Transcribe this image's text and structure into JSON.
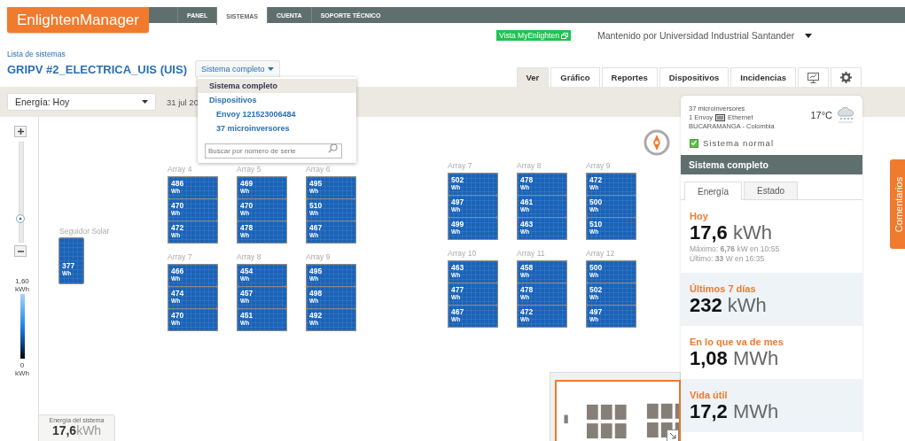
{
  "header": {
    "logo": "EnlightenManager",
    "nav": [
      {
        "label": "PANEL",
        "selected": false
      },
      {
        "label": "SISTEMAS",
        "selected": true
      },
      {
        "label": "CUENTA",
        "selected": false
      },
      {
        "label": "SOPORTE TÉCNICO",
        "selected": false
      }
    ]
  },
  "myenlighten_link": "Vista MyEnlighten",
  "maintainer": "Mantenido por Universidad Industrial Santander",
  "breadcrumb": "Lista de sistemas",
  "system_title": "GRIPV #2_ELECTRICA_UIS (UIS)",
  "scope_dropdown": {
    "value": "Sistema completo",
    "expanded": true,
    "items": [
      {
        "label": "Sistema completo",
        "kind": "option",
        "selected": true
      },
      {
        "label": "Dispositivos",
        "kind": "heading",
        "selected": false
      },
      {
        "label": "Envoy 121523006484",
        "kind": "device",
        "selected": false
      },
      {
        "label": "37 microinversores",
        "kind": "device",
        "selected": false
      }
    ],
    "search_placeholder": "Buscar por número de serie"
  },
  "view_tabs": [
    {
      "kind": "text",
      "label": "Ver",
      "selected": true
    },
    {
      "kind": "text",
      "label": "Gráfico",
      "selected": false
    },
    {
      "kind": "text",
      "label": "Reportes",
      "selected": false
    },
    {
      "kind": "text",
      "label": "Dispositivos",
      "selected": false
    },
    {
      "kind": "text",
      "label": "Incidencias",
      "selected": false
    },
    {
      "kind": "display",
      "selected": false
    },
    {
      "kind": "settings",
      "selected": false
    }
  ],
  "energy_select": "Energía: Hoy",
  "date": "31 jul 20",
  "zoom": {
    "level": 0.24
  },
  "legend": {
    "max": "1,60",
    "max_unit": "kWh",
    "min": "0",
    "min_unit": "kWh"
  },
  "tracker": {
    "label": "Seguidor Solar",
    "value": "377",
    "unit": "Wh"
  },
  "array_groups": [
    {
      "arrays": [
        {
          "label": "Array 4",
          "panels": [
            {
              "value": "486",
              "unit": "Wh"
            },
            {
              "value": "470",
              "unit": "Wh"
            },
            {
              "value": "472",
              "unit": "Wh"
            }
          ]
        },
        {
          "label": "Array 5",
          "panels": [
            {
              "value": "469",
              "unit": "Wh"
            },
            {
              "value": "470",
              "unit": "Wh"
            },
            {
              "value": "478",
              "unit": "Wh"
            }
          ]
        },
        {
          "label": "Array 6",
          "panels": [
            {
              "value": "495",
              "unit": "Wh"
            },
            {
              "value": "510",
              "unit": "Wh"
            },
            {
              "value": "467",
              "unit": "Wh"
            }
          ]
        },
        {
          "label": "Array 7",
          "panels": [
            {
              "value": "466",
              "unit": "Wh"
            },
            {
              "value": "474",
              "unit": "Wh"
            },
            {
              "value": "470",
              "unit": "Wh"
            }
          ]
        },
        {
          "label": "Array 8",
          "panels": [
            {
              "value": "454",
              "unit": "Wh"
            },
            {
              "value": "457",
              "unit": "Wh"
            },
            {
              "value": "451",
              "unit": "Wh"
            }
          ]
        },
        {
          "label": "Array 9",
          "panels": [
            {
              "value": "495",
              "unit": "Wh"
            },
            {
              "value": "498",
              "unit": "Wh"
            },
            {
              "value": "492",
              "unit": "Wh"
            }
          ]
        }
      ]
    },
    {
      "arrays": [
        {
          "label": "Array 7",
          "panels": [
            {
              "value": "502",
              "unit": "Wh"
            },
            {
              "value": "497",
              "unit": "Wh"
            },
            {
              "value": "499",
              "unit": "Wh"
            }
          ]
        },
        {
          "label": "Array 8",
          "panels": [
            {
              "value": "478",
              "unit": "Wh"
            },
            {
              "value": "461",
              "unit": "Wh"
            },
            {
              "value": "463",
              "unit": "Wh"
            }
          ]
        },
        {
          "label": "Array 9",
          "panels": [
            {
              "value": "472",
              "unit": "Wh"
            },
            {
              "value": "500",
              "unit": "Wh"
            },
            {
              "value": "510",
              "unit": "Wh"
            }
          ]
        },
        {
          "label": "Array 10",
          "panels": [
            {
              "value": "463",
              "unit": "Wh"
            },
            {
              "value": "477",
              "unit": "Wh"
            },
            {
              "value": "467",
              "unit": "Wh"
            }
          ]
        },
        {
          "label": "Array 11",
          "panels": [
            {
              "value": "458",
              "unit": "Wh"
            },
            {
              "value": "478",
              "unit": "Wh"
            },
            {
              "value": "472",
              "unit": "Wh"
            }
          ]
        },
        {
          "label": "Array 12",
          "panels": [
            {
              "value": "500",
              "unit": "Wh"
            },
            {
              "value": "502",
              "unit": "Wh"
            },
            {
              "value": "497",
              "unit": "Wh"
            }
          ]
        }
      ]
    }
  ],
  "system_energy": {
    "label": "Energía del sistema",
    "value": "17,6",
    "unit": "kWh"
  },
  "summary": {
    "microinverters": "37 microinversores",
    "envoy": "1 Envoy",
    "connection": "Ethernet",
    "location": "BUCARAMANGA - Colombia",
    "temperature": "17°C",
    "status": {
      "label": "Sistema normal",
      "ok": true
    },
    "scope": "Sistema completo",
    "tabs": [
      {
        "label": "Energía",
        "selected": true
      },
      {
        "label": "Estado",
        "selected": false
      }
    ],
    "stats": [
      {
        "title": "Hoy",
        "value": "17,6",
        "unit": "kWh",
        "details": [
          "Máximo: **6,76** kW en 10:55",
          "Último: **33** W en 16:35"
        ]
      },
      {
        "title": "Últimos 7 días",
        "value": "232",
        "unit": "kWh"
      },
      {
        "title": "En lo que va de mes",
        "value": "1,08",
        "unit": "MWh"
      },
      {
        "title": "Vida útil",
        "value": "17,2",
        "unit": "MWh"
      }
    ]
  },
  "feedback_tab": "Comentarios"
}
